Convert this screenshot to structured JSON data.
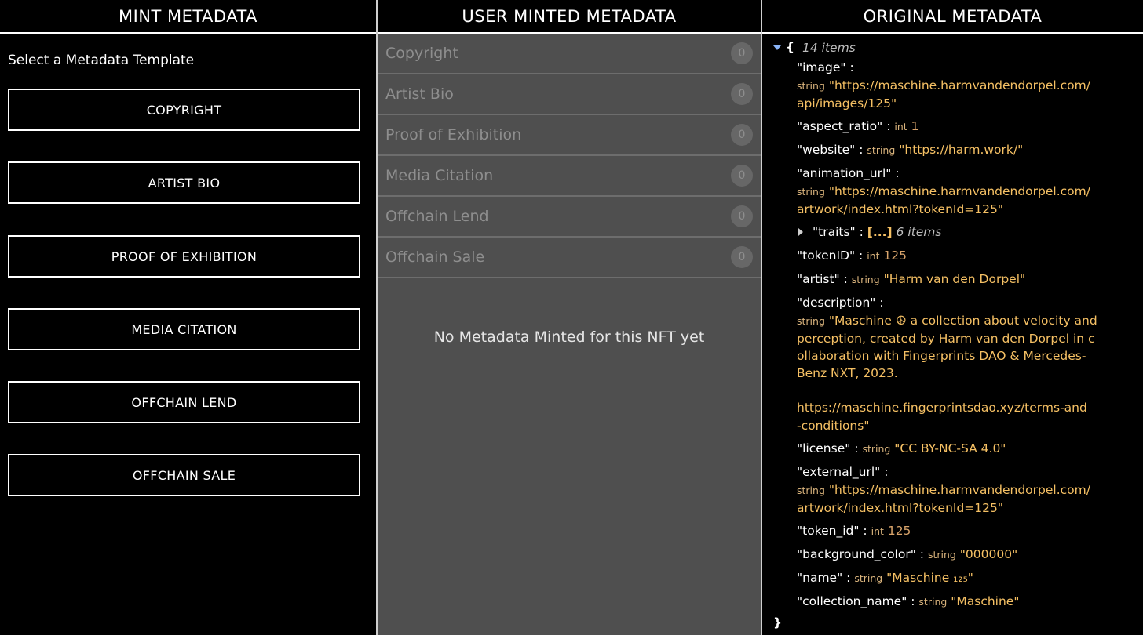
{
  "mint": {
    "header": "MINT METADATA",
    "prompt": "Select a Metadata Template",
    "templates": [
      "COPYRIGHT",
      "ARTIST BIO",
      "PROOF OF EXHIBITION",
      "MEDIA CITATION",
      "OFFCHAIN LEND",
      "OFFCHAIN SALE"
    ]
  },
  "user": {
    "header": "USER MINTED METADATA",
    "rows": [
      {
        "label": "Copyright",
        "count": "0"
      },
      {
        "label": "Artist Bio",
        "count": "0"
      },
      {
        "label": "Proof of Exhibition",
        "count": "0"
      },
      {
        "label": "Media Citation",
        "count": "0"
      },
      {
        "label": "Offchain Lend",
        "count": "0"
      },
      {
        "label": "Offchain Sale",
        "count": "0"
      }
    ],
    "empty_message": "No Metadata Minted for this NFT yet"
  },
  "original": {
    "header": "ORIGINAL METADATA",
    "open_brace": "{",
    "close_brace": "}",
    "count_label": "14 items",
    "lines": {
      "image_key": "\"image\" :",
      "image_type": "string",
      "image_v1": "\"https://maschine.harmvandendorpel.com/",
      "image_v2": "api/images/125\"",
      "aspect_key": "\"aspect_ratio\" :",
      "aspect_type": "int",
      "aspect_val": "1",
      "website_key": "\"website\" :",
      "website_type": "string",
      "website_val": "\"https://harm.work/\"",
      "anim_key": "\"animation_url\" :",
      "anim_type": "string",
      "anim_v1": "\"https://maschine.harmvandendorpel.com/",
      "anim_v2": "artwork/index.html?tokenId=125\"",
      "traits_key": "\"traits\" :",
      "traits_val": "[...]",
      "traits_count": "6 items",
      "tokenID_key": "\"tokenID\" :",
      "tokenID_type": "int",
      "tokenID_val": "125",
      "artist_key": "\"artist\" :",
      "artist_type": "string",
      "artist_val": "\"Harm van den Dorpel\"",
      "desc_key": "\"description\" :",
      "desc_type": "string",
      "desc_v1": "\"Maschine ☮ a collection about velocity and",
      "desc_v2": "perception, created by Harm van den Dorpel in c",
      "desc_v3": "ollaboration with Fingerprints DAO & Mercedes-",
      "desc_v4": "Benz NXT, 2023.",
      "desc_v5": "https://maschine.fingerprintsdao.xyz/terms-and",
      "desc_v6": "-conditions\"",
      "license_key": "\"license\" :",
      "license_type": "string",
      "license_val": "\"CC BY-NC-SA 4.0\"",
      "ext_key": "\"external_url\" :",
      "ext_type": "string",
      "ext_v1": "\"https://maschine.harmvandendorpel.com/",
      "ext_v2": "artwork/index.html?tokenId=125\"",
      "token_id_key": "\"token_id\" :",
      "token_id_type": "int",
      "token_id_val": "125",
      "bg_key": "\"background_color\" :",
      "bg_type": "string",
      "bg_val": "\"000000\"",
      "name_key": "\"name\" :",
      "name_type": "string",
      "name_val": "\"Maschine ₁₂₅\"",
      "coll_key": "\"collection_name\" :",
      "coll_type": "string",
      "coll_val": "\"Maschine\""
    }
  }
}
